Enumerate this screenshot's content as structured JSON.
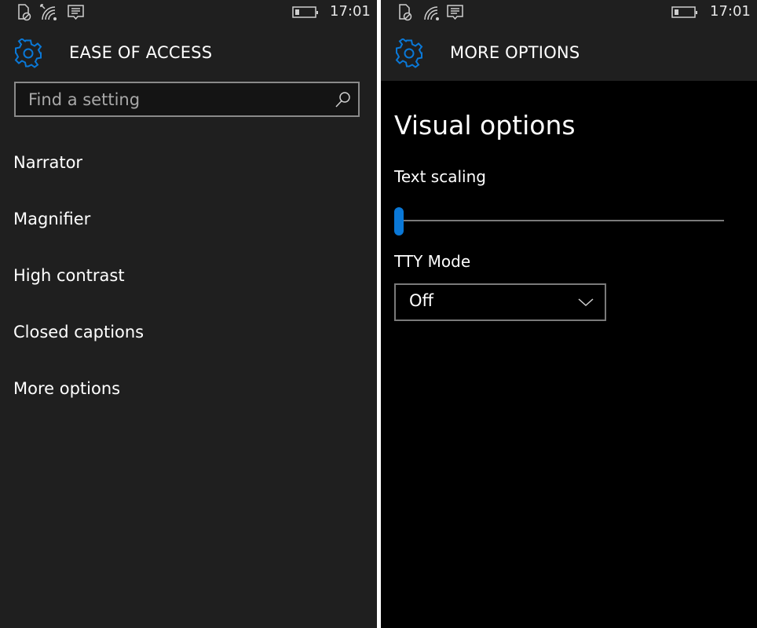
{
  "theme": {
    "accent": "#0a78d7",
    "panel_bg": "#1f1f1f",
    "content_bg": "#000000",
    "divider": "#ffffff"
  },
  "left": {
    "status_bar": {
      "icons": [
        "sim-blocked-icon",
        "wifi-icon",
        "message-icon"
      ],
      "battery_icon": "battery-low-icon",
      "time": "17:01"
    },
    "header": {
      "icon": "gear-icon",
      "title": "EASE OF ACCESS"
    },
    "search": {
      "placeholder": "Find a setting",
      "value": "",
      "icon": "search-icon"
    },
    "menu": {
      "items": [
        {
          "label": "Narrator"
        },
        {
          "label": "Magnifier"
        },
        {
          "label": "High contrast"
        },
        {
          "label": "Closed captions"
        },
        {
          "label": "More options"
        }
      ]
    }
  },
  "right": {
    "status_bar": {
      "icons": [
        "sim-blocked-icon",
        "wifi-icon",
        "message-icon"
      ],
      "battery_icon": "battery-low-icon",
      "time": "17:01"
    },
    "header": {
      "icon": "gear-icon",
      "title": "MORE OPTIONS"
    },
    "section_title": "Visual options",
    "text_scaling": {
      "label": "Text scaling",
      "value_fraction": 0.0
    },
    "tty_mode": {
      "label": "TTY Mode",
      "selected": "Off",
      "icon": "chevron-down-icon"
    }
  }
}
